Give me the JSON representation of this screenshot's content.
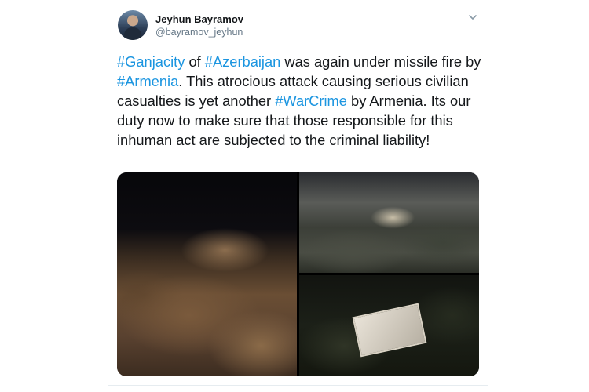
{
  "tweet": {
    "author": {
      "display_name": "Jeyhun Bayramov",
      "handle": "@bayramov_jeyhun"
    },
    "menu_icon": "chevron-down-icon",
    "text_segments": [
      {
        "text": "#Ganjacity",
        "hashtag": true
      },
      {
        "text": " of ",
        "hashtag": false
      },
      {
        "text": "#Azerbaijan",
        "hashtag": true
      },
      {
        "text": " was again under missile fire by ",
        "hashtag": false
      },
      {
        "text": "#Armenia",
        "hashtag": true
      },
      {
        "text": ". This atrocious attack causing serious civilian casualties is yet another ",
        "hashtag": false
      },
      {
        "text": "#WarCrime",
        "hashtag": true
      },
      {
        "text": " by Armenia. Its our duty now to make sure that those responsible for this inhuman act are subjected to the criminal liability!",
        "hashtag": false
      }
    ],
    "colors": {
      "text": "#14171a",
      "hashtag": "#1b95e0",
      "secondary": "#657786",
      "border": "#e6ecf0"
    }
  }
}
